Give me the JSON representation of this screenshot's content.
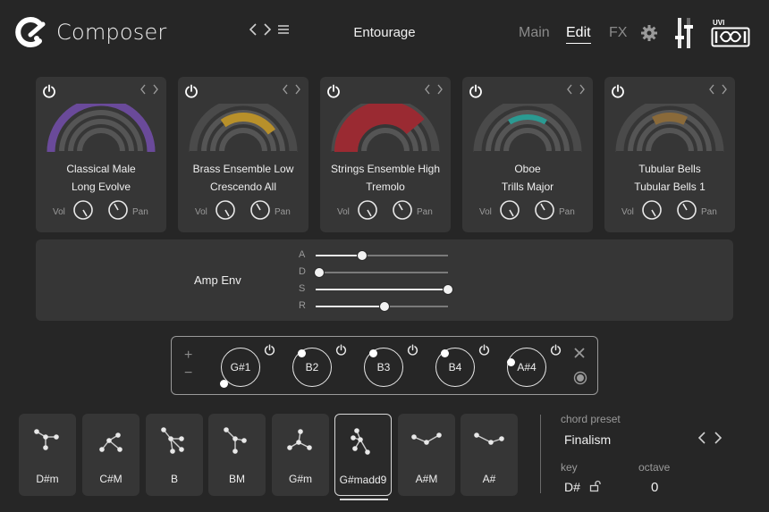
{
  "header": {
    "app_title": "Composer",
    "preset_name": "Entourage",
    "tabs": [
      {
        "label": "Main",
        "active": false
      },
      {
        "label": "Edit",
        "active": true
      },
      {
        "label": "FX",
        "active": false
      }
    ],
    "brand": "UVI",
    "icons": [
      "composer-logo-icon",
      "chevron-left-icon",
      "chevron-right-icon",
      "menu-icon",
      "gear-icon",
      "mixer-icon",
      "uvi-logo-icon"
    ]
  },
  "instruments": [
    {
      "name": "Classical Male",
      "articulation": "Long Evolve",
      "vol_label": "Vol",
      "pan_label": "Pan",
      "color": "#6a4a9a",
      "arc_fraction": 1.0
    },
    {
      "name": "Brass Ensemble Low",
      "articulation": "Crescendo All",
      "vol_label": "Vol",
      "pan_label": "Pan",
      "color": "#b8902a",
      "arc_fraction": 0.5
    },
    {
      "name": "Strings Ensemble High",
      "articulation": "Tremolo",
      "vol_label": "Vol",
      "pan_label": "Pan",
      "color": "#9a2a32",
      "arc_fraction": 0.8
    },
    {
      "name": "Oboe",
      "articulation": "Trills Major",
      "vol_label": "Vol",
      "pan_label": "Pan",
      "color": "#2a9a92",
      "arc_fraction": 0.35
    },
    {
      "name": "Tubular Bells",
      "articulation": "Tubular Bells 1",
      "vol_label": "Vol",
      "pan_label": "Pan",
      "color": "#8a6a3a",
      "arc_fraction": 0.3
    }
  ],
  "amp_env": {
    "title": "Amp Env",
    "params": [
      {
        "label": "A",
        "value": 0.35
      },
      {
        "label": "D",
        "value": 0.03
      },
      {
        "label": "S",
        "value": 1.0
      },
      {
        "label": "R",
        "value": 0.52
      }
    ]
  },
  "chord_notes": {
    "add_label": "+",
    "remove_label": "−",
    "notes": [
      "G#1",
      "B2",
      "B3",
      "B4",
      "A#4"
    ]
  },
  "chords": [
    {
      "label": "D#m",
      "selected": false
    },
    {
      "label": "C#M",
      "selected": false
    },
    {
      "label": "B",
      "selected": false
    },
    {
      "label": "BM",
      "selected": false
    },
    {
      "label": "G#m",
      "selected": false
    },
    {
      "label": "G#madd9",
      "selected": true
    },
    {
      "label": "A#M",
      "selected": false
    },
    {
      "label": "A#",
      "selected": false
    }
  ],
  "chord_preset": {
    "label": "chord preset",
    "value": "Finalism",
    "key_label": "key",
    "key_value": "D#",
    "octave_label": "octave",
    "octave_value": "0"
  }
}
